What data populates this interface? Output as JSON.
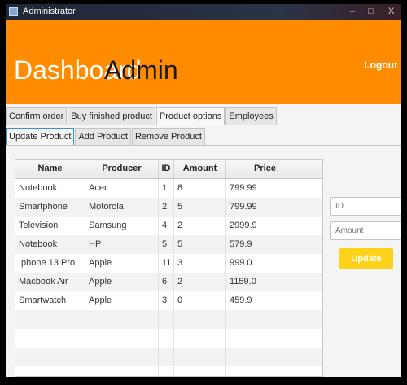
{
  "window": {
    "title": "Administrator",
    "close_glyph": "X"
  },
  "header": {
    "title_part1": "Dashboard",
    "title_part2": "Admin",
    "logout_label": "Logout"
  },
  "main_tabs": [
    "Confirm order",
    "Buy finished product",
    "Product options",
    "Employees"
  ],
  "main_tabs_active": "Product options",
  "sub_tabs": [
    "Update Product",
    "Add Product",
    "Remove Product"
  ],
  "sub_tabs_active": "Update Product",
  "table": {
    "columns": [
      "Name",
      "Producer",
      "ID",
      "Amount",
      "Price"
    ],
    "rows": [
      [
        "Notebook",
        "Acer",
        "1",
        "8",
        "799.99"
      ],
      [
        "Smartphone",
        "Motorola",
        "2",
        "5",
        "799.99"
      ],
      [
        "Television",
        "Samsung",
        "4",
        "2",
        "2999.9"
      ],
      [
        "Notebook",
        "HP",
        "5",
        "5",
        "579.9"
      ],
      [
        "Iphone 13 Pro",
        "Apple",
        "11",
        "3",
        "999.0"
      ],
      [
        "Macbook Air",
        "Apple",
        "6",
        "2",
        "1159.0"
      ],
      [
        "Smartwatch",
        "Apple",
        "3",
        "0",
        "459.9"
      ]
    ]
  },
  "form": {
    "id_placeholder": "ID",
    "amount_placeholder": "Amount",
    "update_label": "Update"
  },
  "colors": {
    "header_bg": "#ff8c00",
    "update_button": "#ffd21a"
  }
}
